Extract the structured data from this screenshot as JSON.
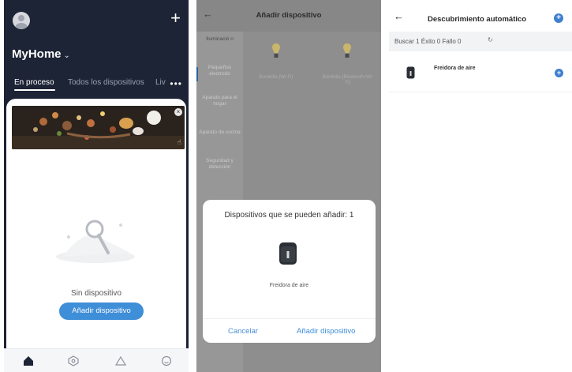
{
  "panel1": {
    "home_name": "MyHome",
    "home_chevron": "⌄",
    "add_icon": "+",
    "tabs": [
      {
        "label": "En proceso"
      },
      {
        "label": "Todos los dispositivos"
      },
      {
        "label": "Liv"
      }
    ],
    "more_icon": "•••",
    "banner_close_icon": "×",
    "banner_hand_icon": "☝",
    "empty_text": "Sin dispositivo",
    "add_device_button": "Añadir dispositivo",
    "navbar_icons": [
      "home-icon",
      "smart-icon",
      "scene-icon",
      "profile-icon"
    ]
  },
  "panel2": {
    "back_icon": "←",
    "title": "Añadir dispositivo",
    "categories": [
      {
        "label": "Iluminació n"
      },
      {
        "label": "Pequeños electrodo"
      },
      {
        "label": "Aparato para el hogar"
      },
      {
        "label": "Aparato de cocina"
      },
      {
        "label": "Seguridad y detección"
      }
    ],
    "bulbs": [
      {
        "label": "Bombilla (Wi-Fi)"
      },
      {
        "label": "Bombilla (Bluetooth+Wi-Fi)"
      }
    ],
    "dialog": {
      "title": "Dispositivos que se pueden añadir: 1",
      "device_name": "Freidora de aire",
      "cancel": "Cancelar",
      "add": "Añadir dispositivo"
    }
  },
  "panel3": {
    "back_icon": "←",
    "title": "Descubrimiento automático",
    "header_add_icon": "+",
    "status": "Buscar 1  Éxito 0  Fallo 0",
    "refresh_icon": "↻",
    "device_name": "Freidora de aire",
    "device_add_icon": "+"
  },
  "colors": {
    "accent": "#3f8ed8",
    "dark_header": "#1d2435",
    "overlay_gray": "#8e8e8e"
  }
}
